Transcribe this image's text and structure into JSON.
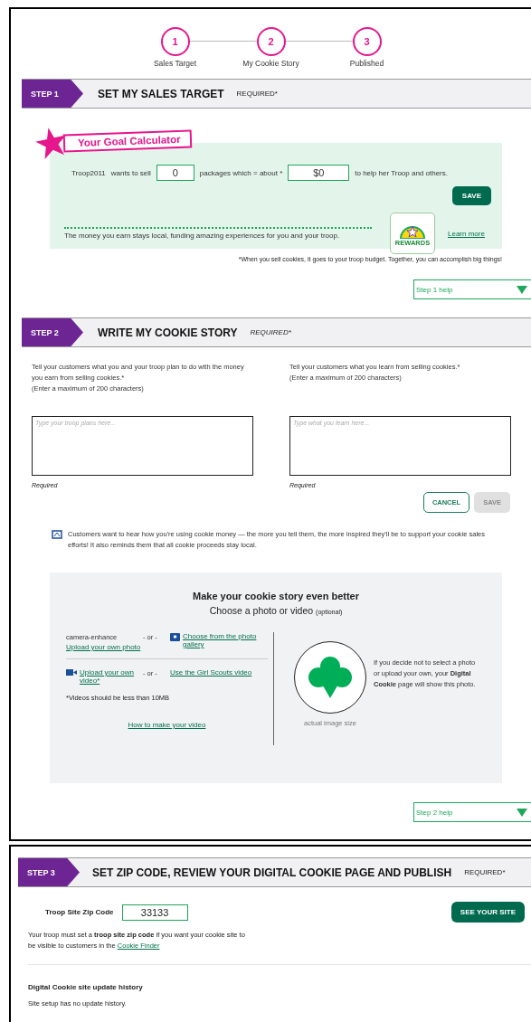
{
  "stepper": [
    {
      "number": "1",
      "label": "Sales Target"
    },
    {
      "number": "2",
      "label": "My Cookie Story"
    },
    {
      "number": "3",
      "label": "Published"
    }
  ],
  "step1": {
    "tag": "STEP 1",
    "title": "SET MY SALES TARGET",
    "required": "REQUIRED*",
    "calculator": {
      "badge": "Your Goal Calculator",
      "troop": "Troop2011",
      "wants": "wants to sell",
      "packages": "0",
      "which": "packages which = about *",
      "amount": "$0",
      "after": "to help her Troop and others.",
      "save": "SAVE",
      "money_note": "The money you earn stays local, funding amazing experiences for you and your troop.",
      "rewards": "REWARDS",
      "learn_more": "Learn more"
    },
    "footnote": "*When you sell cookies, it goes to your troop budget. Together, you can accomplish big things!",
    "help": "Step 1 help"
  },
  "step2": {
    "tag": "STEP 2",
    "title": "WRITE MY COOKIE STORY",
    "required": "REQUIRED*",
    "fields": [
      {
        "prompt": "Tell your customers what you and your troop plan to do with the money you earn from selling cookies.*",
        "limit": "(Enter a maximum of 200 characters)",
        "placeholder": "Type your troop plans here...",
        "note": "Required"
      },
      {
        "prompt": "Tell your customers what you learn from selling cookies.*",
        "limit": "(Enter a maximum of 200 characters)",
        "placeholder": "Type what you learn here...",
        "note": "Required"
      }
    ],
    "cancel": "CANCEL",
    "save": "SAVE",
    "info": "Customers want to hear how you're using cookie money — the more you tell them, the more inspired they'll be to support your cookie sales efforts! It also reminds them that all cookie proceeds stay local.",
    "media": {
      "title": "Make your cookie story even better",
      "subtitle": "Choose a photo or video",
      "optional": "(optional)",
      "photo_alt": "camera-enhance",
      "upload_photo": "Upload your own photo",
      "or_1": "- or -",
      "gallery": "Choose from the photo gallery",
      "upload_video": "Upload your own video*",
      "or_2": "- or -",
      "gs_video": "Use the Girl Scouts video",
      "video_note": "*Videos should be less than 10MB",
      "how_to": "How to make your video",
      "image_caption": "actual image size",
      "default_note": "If you decide not to select a photo or upload your own, your **Digital Cookie** page will show this photo."
    },
    "help": "Step 2 help"
  },
  "step3": {
    "tag": "STEP 3",
    "title": "SET ZIP CODE, REVIEW YOUR DIGITAL COOKIE PAGE AND PUBLISH",
    "required": "REQUIRED*",
    "zip_label": "Troop Site Zip Code",
    "zip": "33133",
    "see_site": "SEE YOUR SITE",
    "notice": "Your troop must set a **troop site zip code** if you want your cookie site to be visible to customers in the",
    "notice_link": "Cookie Finder",
    "history_title": "Digital Cookie site update history",
    "history": "Site setup has no update history."
  }
}
